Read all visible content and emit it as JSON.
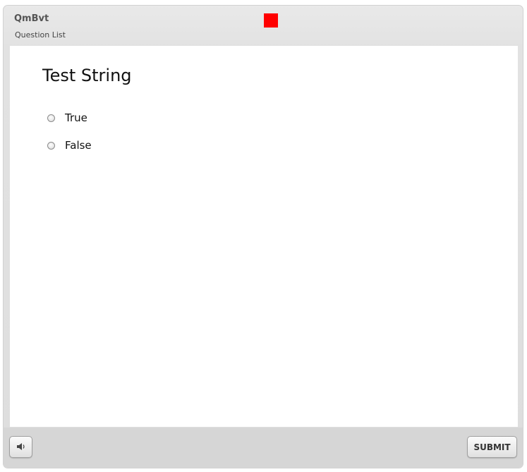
{
  "window": {
    "title": "QmBvt",
    "subtitle": "Question List"
  },
  "question": {
    "text": "Test String",
    "options": [
      {
        "label": "True",
        "selected": false
      },
      {
        "label": "False",
        "selected": false
      }
    ]
  },
  "footer": {
    "audio_icon": "speaker-icon",
    "submit_label": "SUBMIT"
  },
  "colors": {
    "flag": "#ff0000",
    "background": "#e2e2e2",
    "content": "#ffffff"
  }
}
